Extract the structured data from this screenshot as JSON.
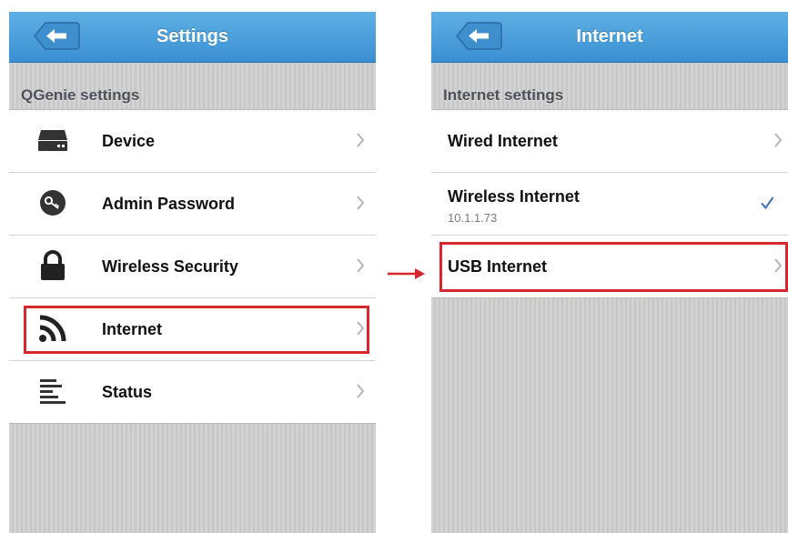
{
  "left_screen": {
    "title": "Settings",
    "section_header": "QGenie settings",
    "items": [
      {
        "label": "Device",
        "icon": "router-icon"
      },
      {
        "label": "Admin Password",
        "icon": "key-icon"
      },
      {
        "label": "Wireless Security",
        "icon": "lock-icon"
      },
      {
        "label": "Internet",
        "icon": "rss-icon",
        "highlighted": true
      },
      {
        "label": "Status",
        "icon": "status-list-icon"
      }
    ]
  },
  "right_screen": {
    "title": "Internet",
    "section_header": "Internet settings",
    "items": [
      {
        "label": "Wired Internet",
        "accessory": "chevron"
      },
      {
        "label": "Wireless Internet",
        "sublabel": "10.1.1.73",
        "accessory": "checkmark",
        "selected": true
      },
      {
        "label": "USB Internet",
        "accessory": "chevron",
        "highlighted": true
      }
    ]
  },
  "colors": {
    "navbar": "#3a8fd2",
    "highlight": "#d6262e",
    "checkmark": "#3a6fb0"
  }
}
